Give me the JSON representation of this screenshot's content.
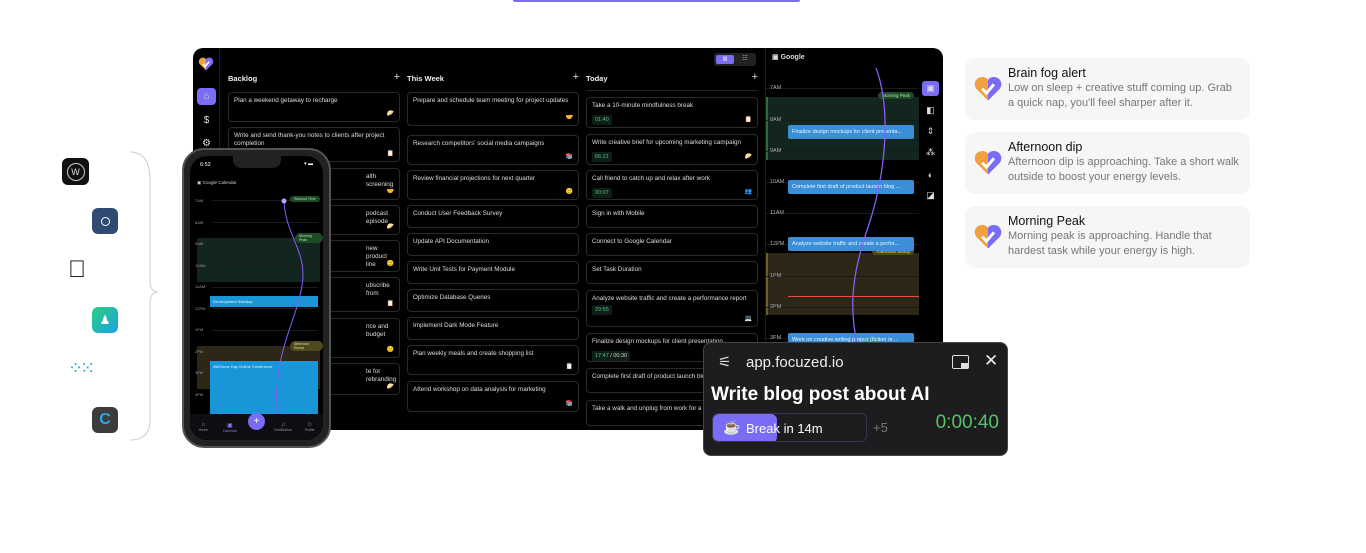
{
  "sidebar": {
    "items": [
      "home",
      "billing",
      "settings"
    ]
  },
  "columns": [
    {
      "title": "Backlog",
      "cards": [
        {
          "text": "Plan a weekend getaway to recharge"
        },
        {
          "text": "Write and send thank-you notes to clients after project completion"
        },
        {
          "text": "alth screening"
        },
        {
          "text": "podcast episode"
        },
        {
          "text": "new product line"
        },
        {
          "text": "ubscribe from"
        },
        {
          "text": "nce and budget"
        },
        {
          "text": "te for rebranding"
        }
      ]
    },
    {
      "title": "This Week",
      "cards": [
        {
          "text": "Prepare and schedule team meeting for project updates"
        },
        {
          "text": "Research competitors' social media campaigns"
        },
        {
          "text": "Review financial projections for next quarter"
        },
        {
          "text": "Conduct User Feedback Survey"
        },
        {
          "text": "Update API Documentation"
        },
        {
          "text": "Write Unit Tests for Payment Module"
        },
        {
          "text": "Optimize Database Queries"
        },
        {
          "text": "Implement Dark Mode Feature"
        },
        {
          "text": "Plan weekly meals and create shopping list"
        },
        {
          "text": "Attend workshop on data analysis for marketing"
        }
      ]
    },
    {
      "title": "Today",
      "cards": [
        {
          "text": "Take a 10-minute mindfulness break",
          "timer": "01:40"
        },
        {
          "text": "Write creative brief for upcoming marketing campaign",
          "timer": "66:21"
        },
        {
          "text": "Call friend to catch up and relax after work",
          "timer": "00:07"
        },
        {
          "text": "Sign in with Mobile"
        },
        {
          "text": "Connect to Google Calendar"
        },
        {
          "text": "Set Task Duration"
        },
        {
          "text": "Analyze website traffic and create a performance report",
          "timer": "29:55"
        },
        {
          "text": "Finalize design mockups for client presentation",
          "timer": "17:47",
          "timer_total": "/ 00:30"
        },
        {
          "text": "Complete first draft of product launch blog post"
        },
        {
          "text": "Take a walk and unplug from work for a bit"
        }
      ]
    }
  ],
  "calendar": {
    "title": "Google",
    "hours": [
      "7AM",
      "8AM",
      "9AM",
      "10AM",
      "11AM",
      "12PM",
      "1PM",
      "2PM",
      "3PM"
    ],
    "badges": {
      "morning": "Morning Peak",
      "afternoon": "Afternoon Slump"
    },
    "events": [
      "Finalize design mockups for client presenta...",
      "Complete first draft of product launch blog ...",
      "Analyze website traffic and create a perfor...",
      "Work on creative writing project (fiction or..."
    ]
  },
  "phone": {
    "time": "6:52",
    "calendar_title": "Google Calendar",
    "hours": [
      "7AM",
      "8AM",
      "9AM",
      "10AM",
      "11AM",
      "12PM",
      "1PM",
      "2PM",
      "3PM",
      "4PM"
    ],
    "badges": {
      "workout": "Workout Time",
      "morning": "Morning Peak",
      "afternoon": "Afternoon Slump"
    },
    "events": [
      "Development Standup",
      "AWSome Day Online Conference"
    ],
    "tabs": [
      "Home",
      "Calendar",
      "Notification",
      "Profile"
    ]
  },
  "popup": {
    "site": "app.focuzed.io",
    "task": "Write blog post about AI",
    "break_label": "Break",
    "break_in": "in 14m",
    "more": "+5",
    "timer": "0:00:40",
    "break_progress": 0.42
  },
  "notifications": [
    {
      "title": "Brain fog alert",
      "body": "Low on sleep + creative stuff coming up. Grab a quick nap, you'll feel sharper after it."
    },
    {
      "title": "Afternoon dip",
      "body": "Afternoon dip is approaching. Take a short walk outside to boost your energy levels."
    },
    {
      "title": "Morning Peak",
      "body": "Morning peak is approaching. Handle that hardest task while your energy is high."
    }
  ],
  "integrations": [
    "withings",
    "oura",
    "apple-health",
    "sleep-app",
    "fitbit",
    "garmin-connect"
  ],
  "colors": {
    "accent": "#7b6cf6",
    "timer_green": "#4fc27b",
    "event_blue": "#3a8fd6"
  }
}
